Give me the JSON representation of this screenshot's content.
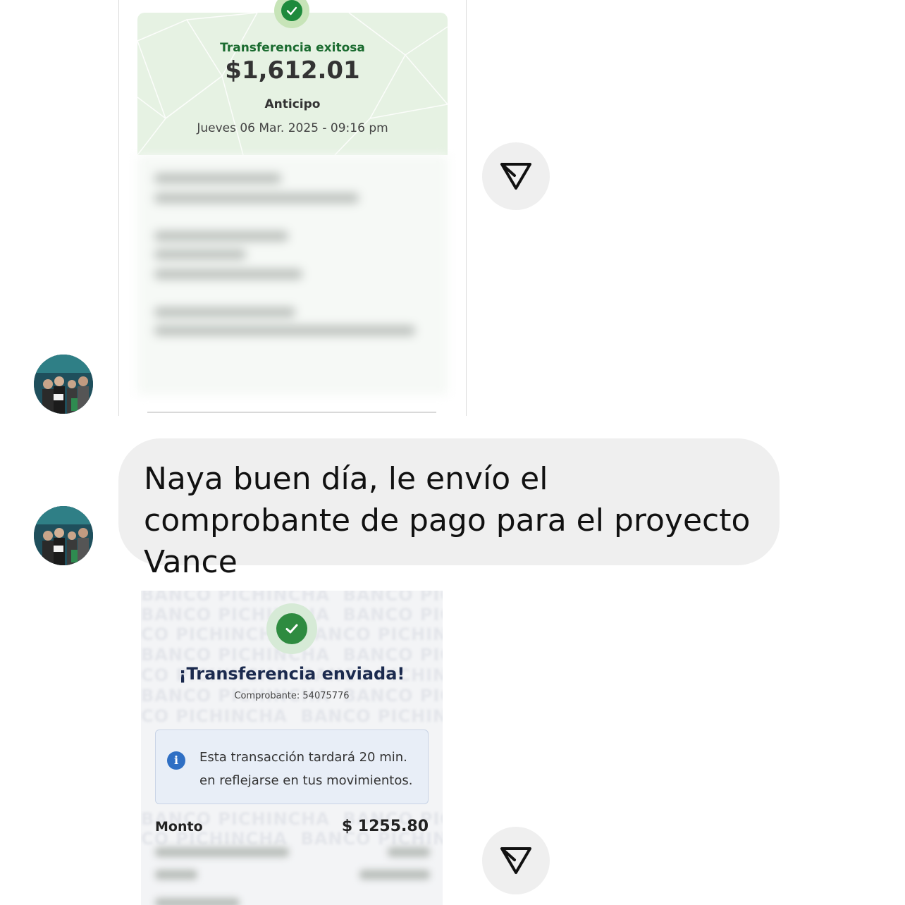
{
  "receipt_green": {
    "status": "Transferencia exitosa",
    "amount": "$1,612.01",
    "concept": "Anticipo",
    "datetime": "Jueves 06 Mar. 2025 - 09:16 pm",
    "accent_color": "#1e8a3c"
  },
  "message": {
    "text": "Naya buen día, le envío el comprobante de pago para el proyecto Vance"
  },
  "receipt_pichincha": {
    "watermark": "BANCO PICHINCHA",
    "title": "¡Transferencia enviada!",
    "reference": "Comprobante: 54075776",
    "info_line1": "Esta transacción tardará 20 min.",
    "info_line2": "en reflejarse en tus movimientos.",
    "amount_label": "Monto",
    "amount_value": "$ 1255.80",
    "accent_color": "#2e8b40"
  },
  "icons": {
    "share": "paper-plane-icon",
    "info": "info-icon",
    "check": "check-icon"
  }
}
